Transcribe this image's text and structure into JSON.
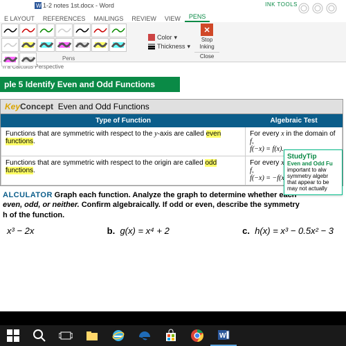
{
  "titlebar": {
    "filename": "1-2 notes 1st.docx - Word",
    "ink_tools": "INK TOOLS"
  },
  "tabs": {
    "layout": "E LAYOUT",
    "references": "REFERENCES",
    "mailings": "MAILINGS",
    "review": "REVIEW",
    "view": "VIEW",
    "pens": "PENS"
  },
  "ribbon": {
    "pens_label": "Pens",
    "color": "Color",
    "thickness": "Thickness",
    "stop": "Stop",
    "inking": "Inking",
    "close": "Close",
    "pen_colors": [
      "#000",
      "#c00",
      "#0a8a00",
      "#ccc",
      "#000",
      "#c00",
      "#0a8a00",
      "#ccc",
      "#ff0",
      "#0ff",
      "#f0f",
      "#ccc",
      "#ff0",
      "#0ff",
      "#f0f",
      "#ccc"
    ]
  },
  "doc": {
    "perspective": "n a Calculus Perspective",
    "example": {
      "num": "ple 5",
      "title": "Identify Even and Odd Functions"
    },
    "kc": {
      "key": "Key",
      "concept": "Concept",
      "title": "Even and Odd Functions",
      "col1": "Type of Function",
      "col2": "Algebraic Test",
      "r1c1a": "Functions that are symmetric with respect to the ",
      "r1c1b": "y",
      "r1c1c": "-axis are called ",
      "r1c1d": "even functions",
      "r1c1e": ".",
      "r1c2a": "For every ",
      "r1c2b": "x",
      "r1c2c": " in the domain of ",
      "r1c2d": "f",
      "r1c2e": ",",
      "r1c2f": "f(−x) = f(x).",
      "r2c1a": "Functions that are symmetric with respect to the origin are called ",
      "r2c1b": "odd functions",
      "r2c1c": ".",
      "r2c2f": "f(−x) = −f(x)."
    },
    "instr": {
      "calc": "ALCULATOR",
      "l1": "Graph each function. Analyze the graph to determine whether each",
      "l2": "even, odd, or neither.",
      "l2b": " Confirm algebraically. If odd or even, describe the symmetry",
      "l3": "h of the function."
    },
    "probs": {
      "a": "x³ − 2x",
      "b_lbl": "b.",
      "b": "g(x) = x⁴ + 2",
      "c_lbl": "c.",
      "c": "h(x) = x³ − 0.5x² − 3"
    },
    "tip": {
      "title": "StudyTip",
      "sub": "Even and Odd Fu",
      "l1": "important to alw",
      "l2": "symmetry algebr",
      "l3": "that appear to be",
      "l4": "may not actually"
    }
  },
  "taskbar": {
    "items": [
      "start",
      "search",
      "taskview",
      "file-explorer",
      "ie",
      "edge",
      "store",
      "chrome",
      "word"
    ]
  }
}
